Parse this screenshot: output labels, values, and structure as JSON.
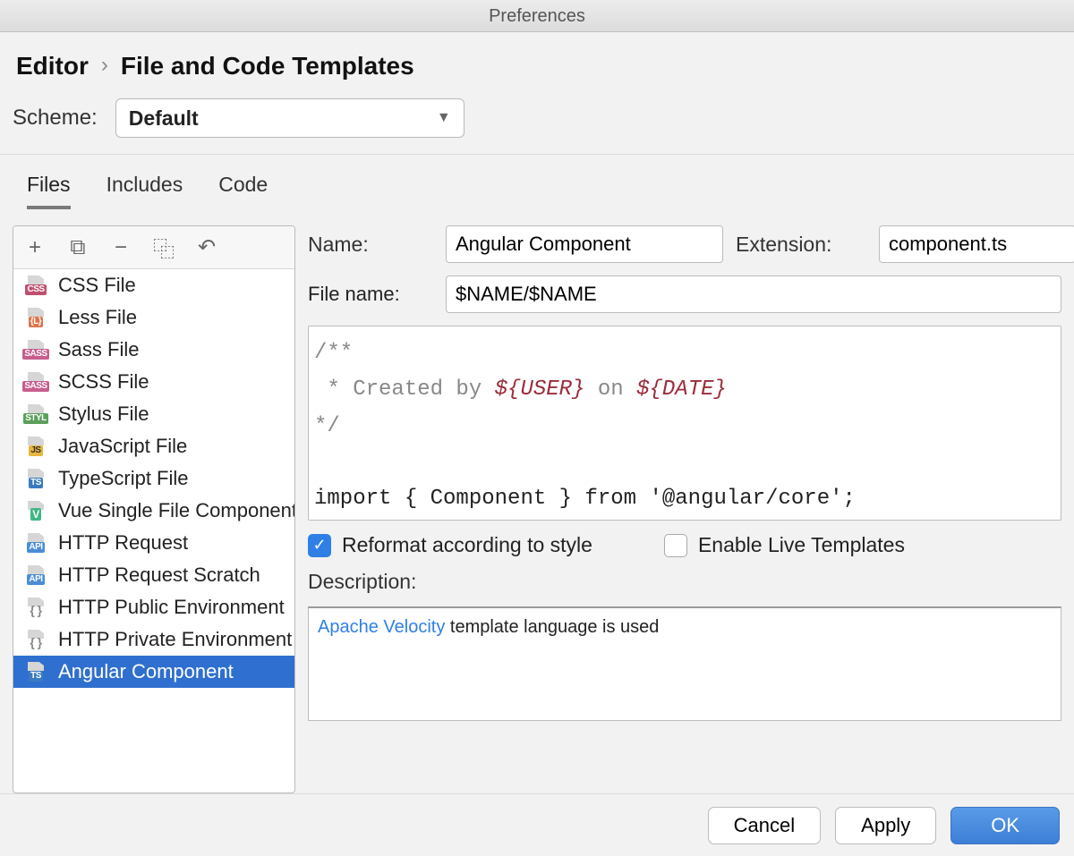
{
  "window": {
    "title": "Preferences"
  },
  "breadcrumb": {
    "root": "Editor",
    "page": "File and Code Templates"
  },
  "scheme": {
    "label": "Scheme:",
    "value": "Default"
  },
  "tabs": {
    "items": [
      "Files",
      "Includes",
      "Code"
    ],
    "active": 0
  },
  "toolbar": {
    "add": "+",
    "add_child": "⧉",
    "remove": "−",
    "copy": "⿻",
    "undo": "↶"
  },
  "files": [
    {
      "badge": "CSS",
      "cls": "b-css",
      "label": "CSS File"
    },
    {
      "badge": "{L}",
      "cls": "b-less",
      "label": "Less File"
    },
    {
      "badge": "SASS",
      "cls": "b-sass",
      "label": "Sass File"
    },
    {
      "badge": "SASS",
      "cls": "b-sass",
      "label": "SCSS File"
    },
    {
      "badge": "STYL",
      "cls": "b-styl",
      "label": "Stylus File"
    },
    {
      "badge": "JS",
      "cls": "b-js",
      "label": "JavaScript File"
    },
    {
      "badge": "TS",
      "cls": "b-ts",
      "label": "TypeScript File"
    },
    {
      "badge": "V",
      "cls": "b-vue",
      "label": "Vue Single File Component"
    },
    {
      "badge": "API",
      "cls": "b-api",
      "label": "HTTP Request"
    },
    {
      "badge": "API",
      "cls": "b-api",
      "label": "HTTP Request Scratch"
    },
    {
      "badge": "{ }",
      "cls": "b-http",
      "label": "HTTP Public Environment"
    },
    {
      "badge": "{ }",
      "cls": "b-http",
      "label": "HTTP Private Environment"
    },
    {
      "badge": "TS",
      "cls": "b-ts",
      "label": "Angular Component",
      "selected": true
    }
  ],
  "form": {
    "name_label": "Name:",
    "name_value": "Angular Component",
    "ext_label": "Extension:",
    "ext_value": "component.ts",
    "filename_label": "File name:",
    "filename_value": "$NAME/$NAME"
  },
  "code": {
    "l1": "/**",
    "l2a": " * Created by ",
    "l2b": "${USER}",
    "l2c": " on ",
    "l2d": "${DATE}",
    "l3": "*/",
    "l4": "",
    "l5": "import { Component } from '@angular/core';"
  },
  "checks": {
    "reformat_label": "Reformat according to style",
    "reformat_checked": true,
    "live_label": "Enable Live Templates",
    "live_checked": false
  },
  "description": {
    "label": "Description:",
    "link": "Apache Velocity",
    "rest": " template language is used"
  },
  "buttons": {
    "cancel": "Cancel",
    "apply": "Apply",
    "ok": "OK"
  }
}
